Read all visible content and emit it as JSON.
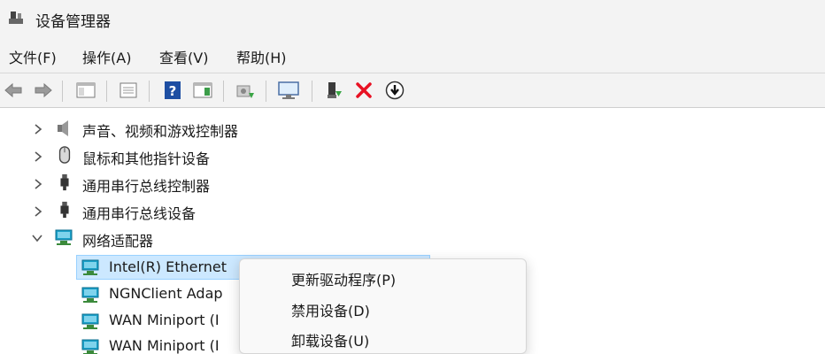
{
  "window": {
    "title": "设备管理器",
    "icon": "device-manager-icon"
  },
  "menu": {
    "items": [
      "文件(F)",
      "操作(A)",
      "查看(V)",
      "帮助(H)"
    ]
  },
  "toolbar": {
    "buttons": [
      "back-arrow-icon",
      "forward-arrow-icon",
      "console-tree-icon",
      "properties-icon",
      "help-icon",
      "action-pane-icon",
      "update-driver-icon",
      "monitor-icon",
      "enable-device-icon",
      "uninstall-x-icon",
      "download-driver-icon"
    ]
  },
  "tree": {
    "items": [
      {
        "label": "声音、视频和游戏控制器",
        "expanded": false,
        "icon": "speaker-icon"
      },
      {
        "label": "鼠标和其他指针设备",
        "expanded": false,
        "icon": "mouse-icon"
      },
      {
        "label": "通用串行总线控制器",
        "expanded": false,
        "icon": "usb-plug-icon"
      },
      {
        "label": "通用串行总线设备",
        "expanded": false,
        "icon": "usb-plug-icon"
      },
      {
        "label": "网络适配器",
        "expanded": true,
        "icon": "network-adapter-icon"
      }
    ],
    "children": [
      {
        "label": "Intel(R) Ethernet",
        "selected": true
      },
      {
        "label": "NGNClient Adap"
      },
      {
        "label": "WAN Miniport (I"
      },
      {
        "label": "WAN Miniport (I"
      }
    ]
  },
  "context_menu": {
    "items": [
      "更新驱动程序(P)",
      "禁用设备(D)",
      "卸载设备(U)"
    ]
  },
  "colors": {
    "selection_bg": "#cce8ff",
    "selection_border": "#99d1ff",
    "chrome_bg": "#f3f3f3",
    "delete_red": "#e81123",
    "help_blue": "#1e4fa3",
    "network_teal": "#1aa0c8"
  }
}
